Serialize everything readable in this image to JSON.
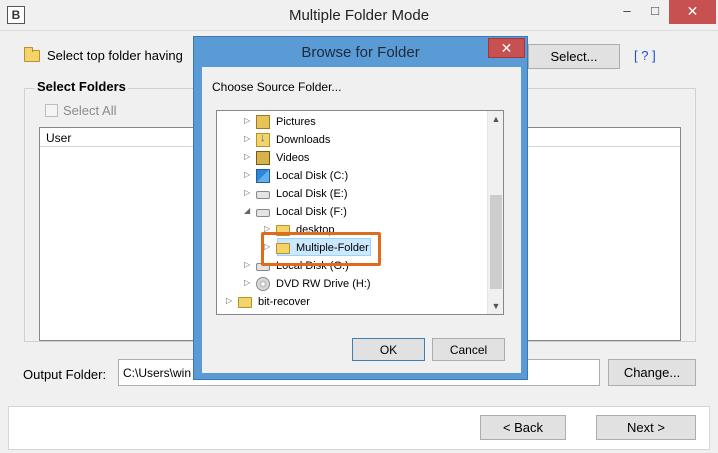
{
  "window": {
    "title": "Multiple Folder Mode",
    "app_icon": "B",
    "minimize": "–",
    "maximize": "□",
    "close": "✕"
  },
  "top_folder": {
    "label": "Select top folder having",
    "select_button": "Select...",
    "help": "[ ? ]"
  },
  "select_folders": {
    "group_label": "Select Folders",
    "select_all": "Select All",
    "columns": [
      "User"
    ]
  },
  "output": {
    "label": "Output Folder:",
    "value": "C:\\Users\\win",
    "change_button": "Change..."
  },
  "navigation": {
    "back": "< Back",
    "next": "Next >"
  },
  "dialog": {
    "title": "Browse for Folder",
    "close": "✕",
    "prompt": "Choose Source Folder...",
    "ok": "OK",
    "cancel": "Cancel",
    "tree": [
      {
        "label": "Pictures",
        "icon": "pictures-icon"
      },
      {
        "label": "Downloads",
        "icon": "downloads-icon"
      },
      {
        "label": "Videos",
        "icon": "videos-icon"
      },
      {
        "label": "Local Disk (C:)",
        "icon": "windows-drive-icon"
      },
      {
        "label": "Local Disk (E:)",
        "icon": "drive-icon"
      },
      {
        "label": "Local Disk (F:)",
        "icon": "drive-icon"
      },
      {
        "label": "desktop",
        "icon": "folder-icon"
      },
      {
        "label": "Multiple-Folder",
        "icon": "folder-icon"
      },
      {
        "label": "Local Disk (G:)",
        "icon": "drive-icon"
      },
      {
        "label": "DVD RW Drive (H:)",
        "icon": "dvd-icon"
      },
      {
        "label": "bit-recover",
        "icon": "folder-icon"
      }
    ]
  }
}
